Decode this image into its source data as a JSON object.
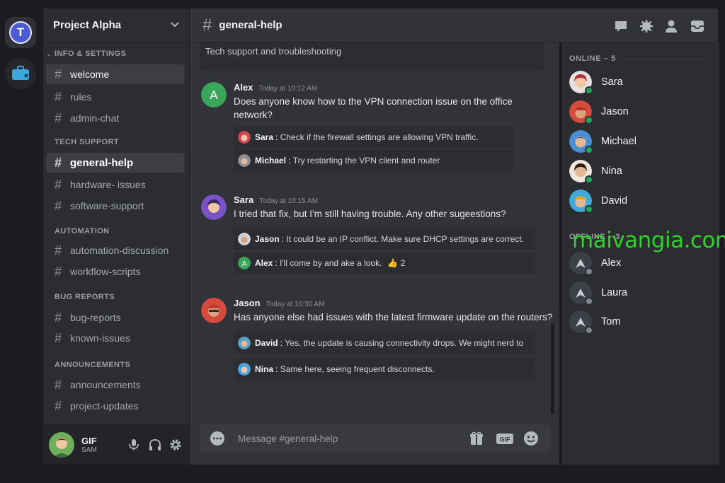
{
  "server": {
    "name": "Project Alpha",
    "rail_initial": "T"
  },
  "sidebar": {
    "categories": [
      {
        "label": "INFO & SETTINGS",
        "channels": [
          "welcome",
          "rules",
          "admin-chat"
        ]
      },
      {
        "label": "TECH SUPPORT",
        "channels": [
          "general-help",
          "hardware- issues",
          "software-support"
        ]
      },
      {
        "label": "AUTOMATION",
        "channels": [
          "automation-discussion",
          "workflow-scripts"
        ]
      },
      {
        "label": "BUG REPORTS",
        "channels": [
          "bug-reports",
          "known-issues"
        ]
      },
      {
        "label": "ANNOUNCEMENTS",
        "channels": [
          "announcements",
          "project-updates"
        ]
      }
    ]
  },
  "user_panel": {
    "name": "GIF",
    "status": "SAM"
  },
  "chat": {
    "channel": "general-help",
    "topic": "Tech support and troubleshooting",
    "composer_placeholder": "Message #general-help",
    "messages": [
      {
        "author": "Alex",
        "time": "Today at 10:12 AM",
        "text": "Does anyone know how to the VPN connection issue on the office network?",
        "replies": [
          {
            "name": "Sara",
            "text": "Check if the firewall settings are allowing VPN traffic."
          },
          {
            "name": "Michael",
            "text": "Try restarting the VPN client and router"
          }
        ]
      },
      {
        "author": "Sara",
        "time": "Today at 10:15 AM",
        "text": "I tried that fix, but I'm still having trouble. Any other sugeestions?",
        "replies": [
          {
            "name": "Jason",
            "text": "It could be an IP conflict. Make sure DHCP settings are correct."
          },
          {
            "name": "Alex",
            "text": "I'll come by and ake a look.",
            "reaction_emoji": "👍",
            "reaction_count": "2"
          }
        ]
      },
      {
        "author": "Jason",
        "time": "Today at 10:30 AM",
        "text": "Has anyone else had issues with the latest firmware update on the routers?",
        "replies": [
          {
            "name": "David",
            "text": "Yes, the update is causing connectivity drops. We might nerd to"
          },
          {
            "name": "Nina",
            "text": "Same here, seeing frequent disconnects."
          }
        ]
      }
    ]
  },
  "members": {
    "online_header": "ONLINE – 5",
    "offline_header": "OFFLINE – 3",
    "online": [
      "Sara",
      "Jason",
      "Michael",
      "Nina",
      "David"
    ],
    "offline": [
      "Alex",
      "Laura",
      "Tom"
    ]
  },
  "colors": {
    "online_dot": "#23a55a",
    "offline_dot": "#80848e",
    "accent": "#5865f2",
    "background": "#313338"
  },
  "watermark": "maivangia.com"
}
